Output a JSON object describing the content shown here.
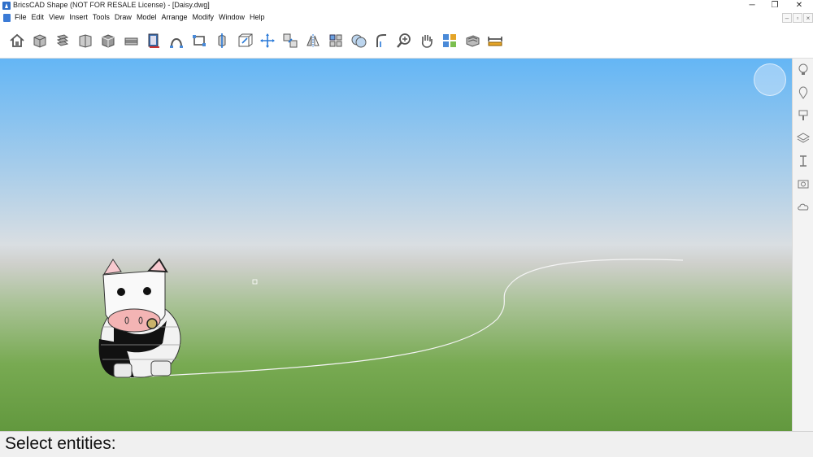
{
  "window": {
    "title": "BricsCAD Shape (NOT FOR RESALE License) - [Daisy.dwg]",
    "minimize_glyph": "─",
    "restore_glyph": "❐",
    "close_glyph": "✕"
  },
  "menu": {
    "items": [
      "File",
      "Edit",
      "View",
      "Insert",
      "Tools",
      "Draw",
      "Model",
      "Arrange",
      "Modify",
      "Window",
      "Help"
    ],
    "doc_minimize_glyph": "–",
    "doc_restore_glyph": "▫",
    "doc_close_glyph": "×"
  },
  "toolbar": {
    "tools": [
      {
        "icon": "home-icon"
      },
      {
        "icon": "box-view-icon"
      },
      {
        "icon": "stack-icon"
      },
      {
        "icon": "open-box-icon"
      },
      {
        "icon": "cube-icon"
      },
      {
        "icon": "extrude-icon"
      },
      {
        "icon": "book-icon"
      },
      {
        "icon": "arc-icon"
      },
      {
        "icon": "rectangle-icon"
      },
      {
        "icon": "push-pull-icon"
      },
      {
        "icon": "frame-box-icon"
      },
      {
        "icon": "move-icon"
      },
      {
        "icon": "copy-icon"
      },
      {
        "icon": "mirror-icon"
      },
      {
        "icon": "array-icon"
      },
      {
        "icon": "union-icon"
      },
      {
        "icon": "fillet-icon"
      },
      {
        "icon": "zoom-icon"
      },
      {
        "icon": "pan-hand-icon"
      },
      {
        "icon": "materials-icon"
      },
      {
        "icon": "render-icon"
      },
      {
        "icon": "measure-icon"
      }
    ]
  },
  "right_panel": {
    "icons": [
      "lightbulb-icon",
      "properties-icon",
      "paint-icon",
      "layers-icon",
      "text-cursor-icon",
      "camera-icon",
      "cloud-icon"
    ]
  },
  "command_line": {
    "prompt": "Select entities:"
  },
  "colors": {
    "accent": "#2f6fc9",
    "sky_top": "#64b6f5",
    "ground": "#62983e"
  }
}
